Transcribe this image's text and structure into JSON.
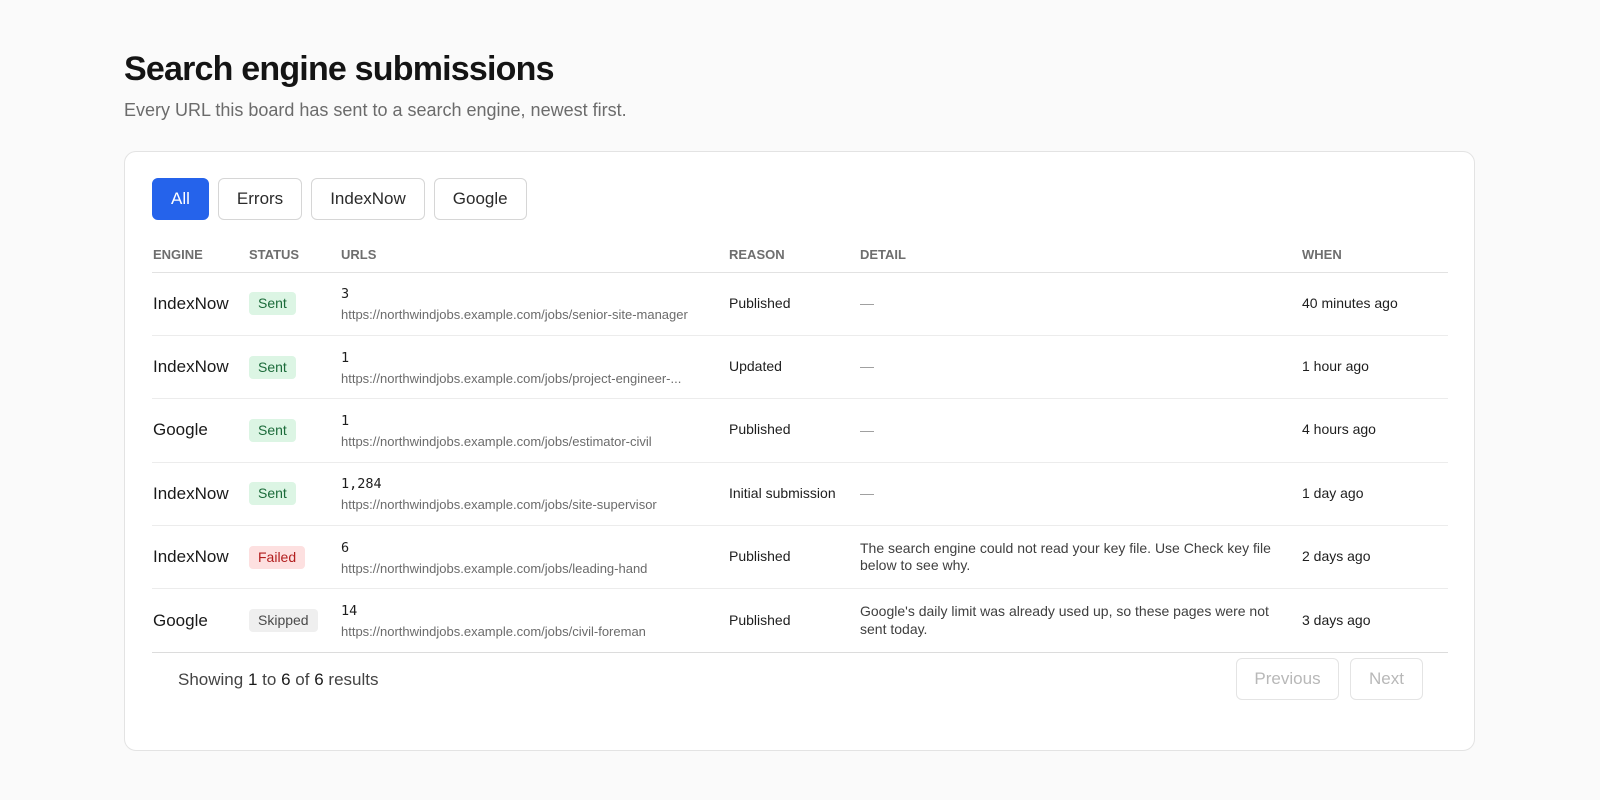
{
  "header": {
    "title": "Search engine submissions",
    "subtitle": "Every URL this board has sent to a search engine, newest first."
  },
  "filters": [
    {
      "label": "All",
      "active": true
    },
    {
      "label": "Errors",
      "active": false
    },
    {
      "label": "IndexNow",
      "active": false
    },
    {
      "label": "Google",
      "active": false
    }
  ],
  "table": {
    "columns": [
      "Engine",
      "Status",
      "URLs",
      "Reason",
      "Detail",
      "When"
    ],
    "rows": [
      {
        "engine": "IndexNow",
        "status": "Sent",
        "status_kind": "sent",
        "count": "3",
        "url": "https://northwindjobs.example.com/jobs/senior-site-manager",
        "reason": "Published",
        "detail": "—",
        "when": "40 minutes ago"
      },
      {
        "engine": "IndexNow",
        "status": "Sent",
        "status_kind": "sent",
        "count": "1",
        "url": "https://northwindjobs.example.com/jobs/project-engineer-...",
        "reason": "Updated",
        "detail": "—",
        "when": "1 hour ago"
      },
      {
        "engine": "Google",
        "status": "Sent",
        "status_kind": "sent",
        "count": "1",
        "url": "https://northwindjobs.example.com/jobs/estimator-civil",
        "reason": "Published",
        "detail": "—",
        "when": "4 hours ago"
      },
      {
        "engine": "IndexNow",
        "status": "Sent",
        "status_kind": "sent",
        "count": "1,284",
        "url": "https://northwindjobs.example.com/jobs/site-supervisor",
        "reason": "Initial submission",
        "detail": "—",
        "when": "1 day ago"
      },
      {
        "engine": "IndexNow",
        "status": "Failed",
        "status_kind": "failed",
        "count": "6",
        "url": "https://northwindjobs.example.com/jobs/leading-hand",
        "reason": "Published",
        "detail": "The search engine could not read your key file. Use Check key file below to see why.",
        "when": "2 days ago"
      },
      {
        "engine": "Google",
        "status": "Skipped",
        "status_kind": "skipped",
        "count": "14",
        "url": "https://northwindjobs.example.com/jobs/civil-foreman",
        "reason": "Published",
        "detail": "Google's daily limit was already used up, so these pages were not sent today.",
        "when": "3 days ago"
      }
    ]
  },
  "footer": {
    "showing_prefix": "Showing",
    "from": "1",
    "to_word": "to",
    "to": "6",
    "of_word": "of",
    "total": "6",
    "results_word": "results",
    "previous_label": "Previous",
    "next_label": "Next"
  },
  "colors": {
    "accent": "#2563eb",
    "sent_bg": "#dcf5e4",
    "failed_bg": "#fde0e0",
    "skipped_bg": "#efefef"
  }
}
